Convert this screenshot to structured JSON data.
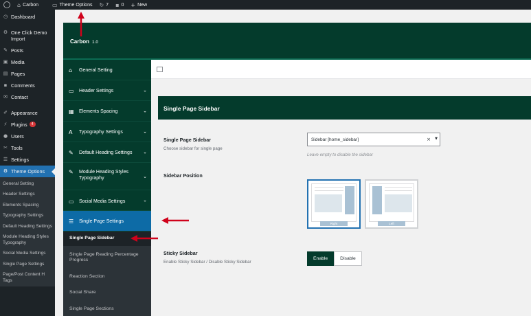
{
  "adminbar": {
    "site": "Carbon",
    "theme_options": "Theme Options",
    "updates": "7",
    "comments": "0",
    "new": "New"
  },
  "wp_menu": {
    "items": [
      {
        "label": "Dashboard",
        "icon": "dashboard-icon"
      },
      {
        "label": "One Click Demo Import",
        "icon": "gear-icon"
      },
      {
        "label": "Posts",
        "icon": "pin-icon"
      },
      {
        "label": "Media",
        "icon": "media-icon"
      },
      {
        "label": "Pages",
        "icon": "pages-icon"
      },
      {
        "label": "Comments",
        "icon": "comment-icon"
      },
      {
        "label": "Contact",
        "icon": "mail-icon"
      },
      {
        "label": "Appearance",
        "icon": "brush-icon"
      },
      {
        "label": "Plugins",
        "icon": "plugin-icon",
        "badge": "4"
      },
      {
        "label": "Users",
        "icon": "users-icon"
      },
      {
        "label": "Tools",
        "icon": "wrench-icon"
      },
      {
        "label": "Settings",
        "icon": "settings-icon"
      },
      {
        "label": "Theme Options",
        "icon": "gear-icon"
      }
    ],
    "sub_items": [
      "General Setting",
      "Header Settings",
      "Elements Spacing",
      "Typography Settings",
      "Default Heading Settings",
      "Module Heading Styles Typography",
      "Social Media Settings",
      "Single Page Settings",
      "Page/Post Content H Tags"
    ]
  },
  "panel": {
    "brand": "Carbon",
    "version": "1.0"
  },
  "opt_nav": {
    "items": [
      "General Setting",
      "Header Settings",
      "Elements Spacing",
      "Typography Settings",
      "Default Heading Settings",
      "Module Heading Styles Typography",
      "Social Media Settings",
      "Single Page Settings"
    ],
    "sub_items": [
      "Single Page Sidebar",
      "Single Page Reading Percentage Progress",
      "Reaction Section",
      "Social Share",
      "Single Page Sections"
    ]
  },
  "section": {
    "title": "Single Page Sidebar",
    "sidebar_label": "Single Page Sidebar",
    "sidebar_desc": "Choose sidebar for single page",
    "sidebar_value": "Sidebar [home_sidebar]",
    "sidebar_hint": "Leave empty to disable the sidebar",
    "position_label": "Sidebar Position",
    "position_right": "Right",
    "position_left": "Left",
    "sticky_label": "Sticky Sidebar",
    "sticky_desc": "Enable Sticky Sidebar / Disable Sticky Sidebar",
    "enable": "Enable",
    "disable": "Disable"
  },
  "colors": {
    "brand_green": "#043b2c",
    "wp_blue": "#2271b1",
    "annotation_red": "#d0021b"
  }
}
